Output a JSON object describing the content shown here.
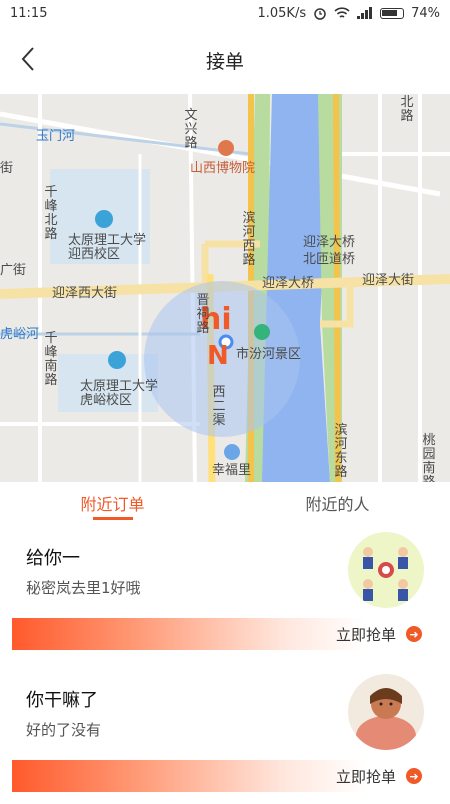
{
  "status": {
    "time": "11:15",
    "speed": "1.05K/s",
    "battery": "74%"
  },
  "header": {
    "title": "接单"
  },
  "map": {
    "labels": {
      "yumenhe": "玉门河",
      "wenxinglu": "文兴路",
      "museum": "山西博物院",
      "beilu": "北路",
      "jie": "街",
      "qianfengbeilu": "千峰北路",
      "tyut_yingxi": "太原理工大学迎西校区",
      "binhexilu": "滨河西路",
      "yingzeqiao": "迎泽大桥",
      "beiza": "北匝道桥",
      "guangjie": "广街",
      "yingzexidajie": "迎泽西大街",
      "yingzedajie_bridge": "迎泽大桥",
      "yingzedajie": "迎泽大街",
      "huyuhe": "虎峪河",
      "qianfengnanlu": "千峰南路",
      "jinyanglu": "晋祠路",
      "fenhe": "市汾河景区",
      "tyut_huyu": "太原理工大学虎峪校区",
      "xierqu": "西二渠",
      "xingfuli": "幸福里",
      "binhedonglu": "滨河东路",
      "taoyuannanlu": "桃园南路"
    },
    "accent": "#f05a28"
  },
  "tabs": [
    {
      "label": "附近订单",
      "active": true
    },
    {
      "label": "附近的人",
      "active": false
    }
  ],
  "orders": [
    {
      "name": "给你一",
      "desc": "秘密岚去里1好哦",
      "action": "立即抢单",
      "avatar": "kids-illustration"
    },
    {
      "name": "你干嘛了",
      "desc": "好的了没有",
      "action": "立即抢单",
      "avatar": "cartoon-woman"
    }
  ]
}
